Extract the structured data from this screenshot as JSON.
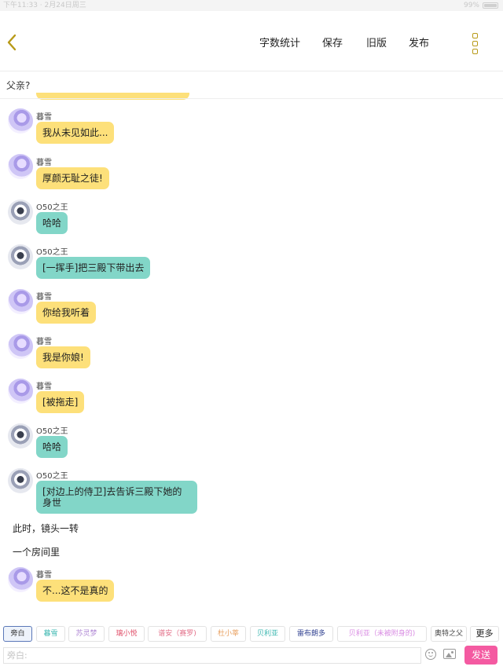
{
  "status_bar": {
    "time_date": "下午11:33 · 2月24日周三",
    "battery": "99%",
    "battery_level": 0.99,
    "icons": [
      "wifi-icon",
      "location-icon",
      "battery-icon"
    ]
  },
  "nav": {
    "actions": [
      "字数统计",
      "保存",
      "旧版",
      "发布"
    ],
    "back_icon": "chevron-left-icon",
    "menu_icon": "more-vertical-icon",
    "accent_color": "#b89a18"
  },
  "chapter_title": "父亲?",
  "messages": [
    {
      "type": "chat",
      "speaker": "暮雪",
      "text": "我从未见如此...",
      "color": "#fde07a"
    },
    {
      "type": "chat",
      "speaker": "暮雪",
      "text": "厚颜无耻之徒!",
      "color": "#fde07a"
    },
    {
      "type": "chat",
      "speaker": "O50之王",
      "text": "哈哈",
      "color": "#82d6c8"
    },
    {
      "type": "chat",
      "speaker": "O50之王",
      "text": "[一挥手]把三殿下带出去",
      "color": "#82d6c8"
    },
    {
      "type": "chat",
      "speaker": "暮雪",
      "text": "你给我听着",
      "color": "#fde07a"
    },
    {
      "type": "chat",
      "speaker": "暮雪",
      "text": "我是你娘!",
      "color": "#fde07a"
    },
    {
      "type": "chat",
      "speaker": "暮雪",
      "text": "[被拖走]",
      "color": "#fde07a"
    },
    {
      "type": "chat",
      "speaker": "O50之王",
      "text": "哈哈",
      "color": "#82d6c8"
    },
    {
      "type": "chat",
      "speaker": "O50之王",
      "text": "[对边上的侍卫]去告诉三殿下她的身世",
      "color": "#82d6c8"
    },
    {
      "type": "narration",
      "text": "此时，镜头一转"
    },
    {
      "type": "narration",
      "text": "一个房间里"
    },
    {
      "type": "chat",
      "speaker": "暮雪",
      "text": "不...这不是真的",
      "color": "#fde07a"
    }
  ],
  "roles": [
    {
      "label": "旁白",
      "color": "#333333",
      "active": true
    },
    {
      "label": "暮雪",
      "color": "#3bb7b0"
    },
    {
      "label": "苏灵梦",
      "color": "#b28bd6"
    },
    {
      "label": "璃小悦",
      "color": "#e0506a"
    },
    {
      "label": "谱安（赛罗)",
      "color": "#e3708a"
    },
    {
      "label": "杜小莘",
      "color": "#e8a060"
    },
    {
      "label": "贝利亚",
      "color": "#3bb7b0"
    },
    {
      "label": "雷布朗多",
      "color": "#2d3e8f"
    },
    {
      "label": "贝利亚（未被附身的)",
      "color": "#d98be3"
    },
    {
      "label": "奥特之父",
      "color": "#444444"
    }
  ],
  "more_label": "更多",
  "input": {
    "placeholder": "旁白:",
    "emoji_icon": "emoji-icon",
    "image_icon": "image-icon",
    "send_label": "发送",
    "send_color": "#f45aa1"
  }
}
